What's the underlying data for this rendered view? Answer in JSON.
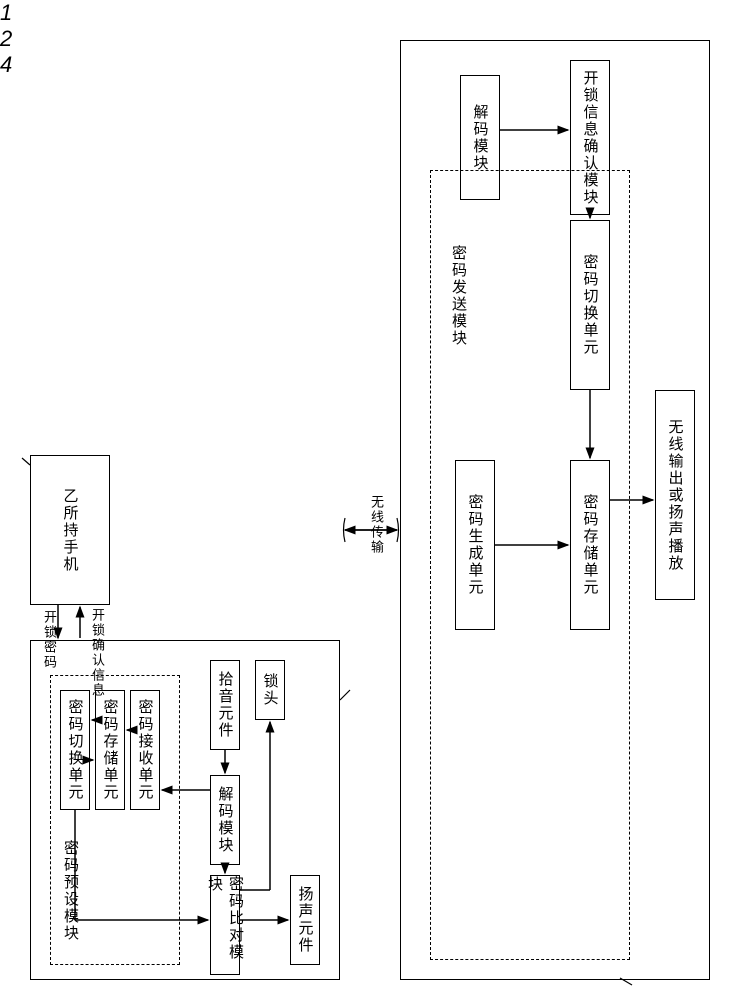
{
  "phone": "乙所持手机",
  "transmission": "无线传输",
  "unlock_password_label": "开锁密码",
  "unlock_confirm_label": "开锁确认信息",
  "left_container_label": "2",
  "right_container_label": "4",
  "figure_label": "1",
  "left": {
    "pickup": "拾音元件",
    "decode": "解码模块",
    "pwd_receive": "密码接收单元",
    "pwd_store": "密码存储单元",
    "pwd_switch": "密码切换单元",
    "pwd_preset_module": "密码预设模块",
    "pwd_compare": "密码比对模块",
    "speaker": "扬声元件",
    "lock": "锁头"
  },
  "right": {
    "decode": "解码模块",
    "unlock_confirm": "开锁信息确认模块",
    "pwd_switch": "密码切换单元",
    "pwd_store": "密码存储单元",
    "pwd_generate": "密码生成单元",
    "pwd_send_module": "密码发送模块",
    "wireless_output": "无线输出或扬声播放"
  }
}
